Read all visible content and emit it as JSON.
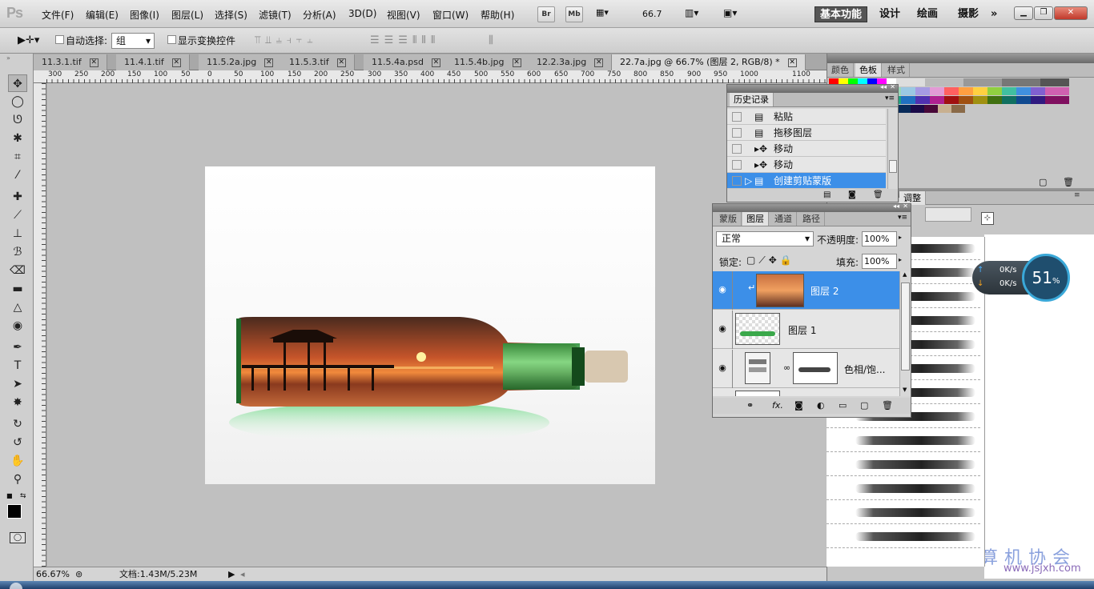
{
  "app": {
    "logo": "Ps"
  },
  "menu": [
    "文件(F)",
    "编辑(E)",
    "图像(I)",
    "图层(L)",
    "选择(S)",
    "滤镜(T)",
    "分析(A)",
    "3D(D)",
    "视图(V)",
    "窗口(W)",
    "帮助(H)"
  ],
  "menu_buttons": {
    "bridge": "Br",
    "mini_bridge": "Mb",
    "zoom": "66.7"
  },
  "workspaces": [
    "基本功能",
    "设计",
    "绘画",
    "摄影"
  ],
  "workspace_more": "»",
  "options": {
    "auto_select_label": "自动选择:",
    "auto_select_value": "组",
    "show_transform_label": "显示变换控件"
  },
  "tabs": [
    {
      "label": "11.3.1.tif"
    },
    {
      "label": "11.4.1.tif"
    },
    {
      "label": "11.5.2a.jpg"
    },
    {
      "label": "11.5.3.tif"
    },
    {
      "label": "11.5.4a.psd"
    },
    {
      "label": "11.5.4b.jpg"
    },
    {
      "label": "12.2.3a.jpg"
    },
    {
      "label": "22.7a.jpg @ 66.7% (图层 2, RGB/8) *",
      "active": true
    }
  ],
  "ruler_labels": [
    "300",
    "250",
    "200",
    "150",
    "100",
    "50",
    "0",
    "50",
    "100",
    "150",
    "200",
    "250",
    "300",
    "350",
    "400",
    "450",
    "500",
    "550",
    "600",
    "650",
    "700",
    "750",
    "800",
    "850",
    "900",
    "950",
    "1000",
    "1100"
  ],
  "status": {
    "zoom": "66.67%",
    "doc": "文档:1.43M/5.23M"
  },
  "swatches_panel": {
    "tabs": [
      "颜色",
      "色板",
      "样式"
    ]
  },
  "history_panel": {
    "title": "历史记录",
    "items": [
      {
        "label": "粘贴",
        "icon": "document-icon"
      },
      {
        "label": "拖移图层",
        "icon": "document-icon"
      },
      {
        "label": "移动",
        "icon": "move-icon"
      },
      {
        "label": "移动",
        "icon": "move-icon"
      },
      {
        "label": "创建剪贴蒙版",
        "icon": "document-icon",
        "selected": true
      }
    ]
  },
  "layers_panel": {
    "tabs": [
      "蒙版",
      "图层",
      "通道",
      "路径"
    ],
    "blend_mode": "正常",
    "opacity_label": "不透明度:",
    "opacity": "100%",
    "lock_label": "锁定:",
    "fill_label": "填充:",
    "fill": "100%",
    "layers": [
      {
        "name": "图层 2",
        "selected": true
      },
      {
        "name": "图层 1"
      },
      {
        "name": "色相/饱..."
      }
    ]
  },
  "adjust_panel": {
    "tab": "调整"
  },
  "net_widget": {
    "up": "0K/s",
    "down": "0K/s",
    "percent": "51",
    "unit": "%"
  },
  "watermark": {
    "text": "计算机协会",
    "url": "www.jsjxh.com"
  }
}
